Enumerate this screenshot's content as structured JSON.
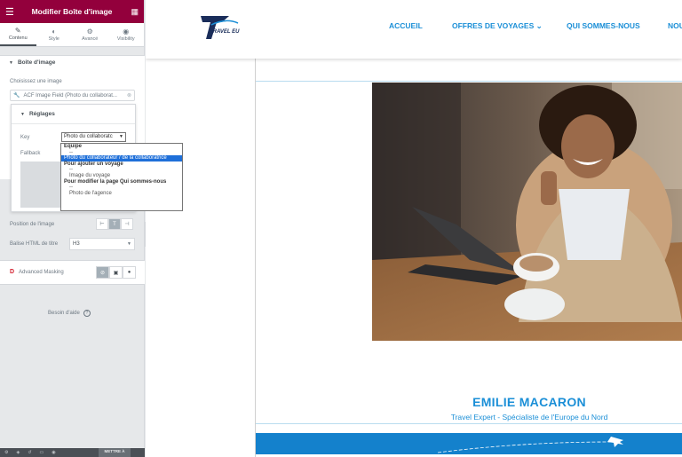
{
  "panel": {
    "title": "Modifier Boîte d'image",
    "tabs": [
      {
        "label": "Contenu",
        "icon": "pencil-icon"
      },
      {
        "label": "Style",
        "icon": "half-circle-icon"
      },
      {
        "label": "Avancé",
        "icon": "gear-icon"
      },
      {
        "label": "Visibility",
        "icon": "eye-icon"
      }
    ],
    "section_title": "Boîte d'image",
    "choose_image_label": "Choisissez une image",
    "acf_field_value": "ACF Image Field (Photo du collaborat...",
    "reglages_title": "Réglages",
    "key_label": "Key",
    "key_value": "Photo du collaboratc",
    "fallback_label": "Fallback",
    "position_label": "Position de l'image",
    "title_tag_label": "Balise HTML de titre",
    "title_tag_value": "H3",
    "masking_label": "Advanced Masking",
    "help_label": "Besoin d'aide",
    "publish_label": "METTRE À"
  },
  "dropdown": [
    {
      "text": "Equipe",
      "kind": "grp"
    },
    {
      "text": "--",
      "kind": "opt"
    },
    {
      "text": "Photo du collaborateur / de la collaboratrice",
      "kind": "sel"
    },
    {
      "text": "Pour ajouter un voyage",
      "kind": "grp"
    },
    {
      "text": "--",
      "kind": "opt"
    },
    {
      "text": "Image du voyage",
      "kind": "opt"
    },
    {
      "text": "Pour modifier la page Qui sommes-nous",
      "kind": "grp"
    },
    {
      "text": "--",
      "kind": "opt"
    },
    {
      "text": "Photo de l'agence",
      "kind": "opt"
    }
  ],
  "site": {
    "logo_text": "TRAVEL EU",
    "nav": [
      "ACCUEIL",
      "OFFRES DE VOYAGES",
      "QUI SOMMES-NOUS",
      "NOU"
    ],
    "person_name": "EMILIE MACARON",
    "person_role": "Travel Expert - Spécialiste de l'Europe du Nord"
  },
  "colors": {
    "panel_header": "#93003c",
    "accent_blue": "#1b8fd7",
    "select_highlight": "#1e6fd9"
  }
}
